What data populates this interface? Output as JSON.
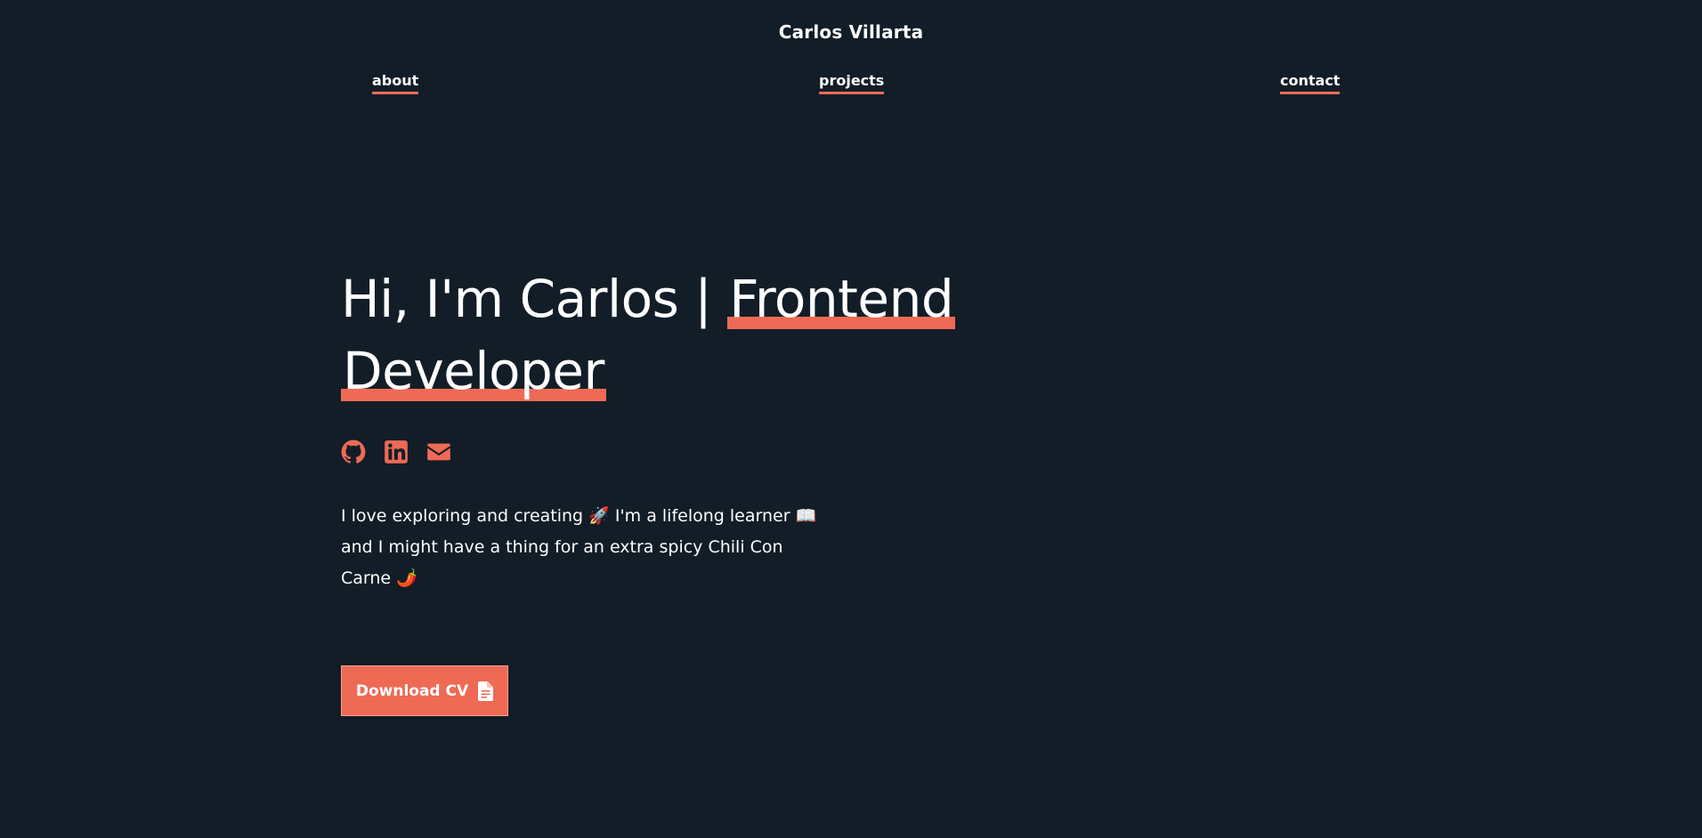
{
  "header": {
    "site_title": "Carlos Villarta"
  },
  "nav": {
    "about": "about",
    "projects": "projects",
    "contact": "contact"
  },
  "hero": {
    "heading_prefix": "Hi, I'm Carlos | ",
    "heading_highlight_1": "Frontend",
    "heading_highlight_2": "Developer"
  },
  "social": {
    "icons": [
      "github-icon",
      "linkedin-icon",
      "mail-icon"
    ]
  },
  "bio": {
    "line_1": "I love exploring and creating 🚀 I'm a lifelong learner 📖",
    "line_2": "and I might have a thing for an extra spicy Chili Con",
    "line_3": "Carne 🌶️"
  },
  "cta": {
    "download_cv_label": "Download CV",
    "icon": "file-document-icon"
  },
  "colors": {
    "background": "#121d27",
    "accent": "#ee6a55",
    "text": "#ffffff"
  }
}
